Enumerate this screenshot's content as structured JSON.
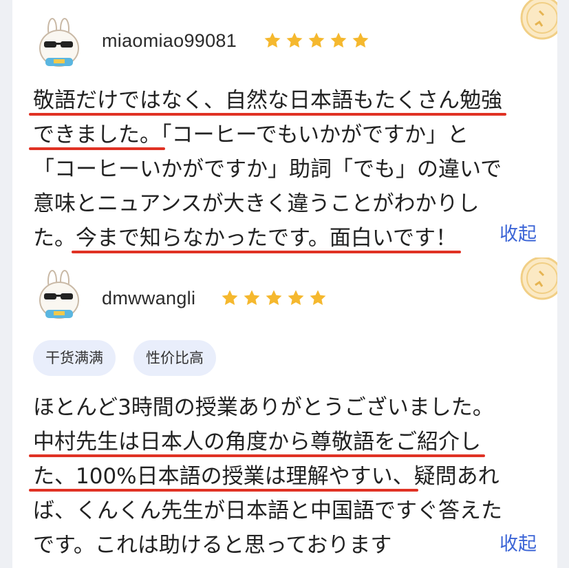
{
  "reviews": [
    {
      "username": "miaomiao99081",
      "rating": 5,
      "lines": [
        [
          {
            "t": "敬語だけではなく、自然な日本語もたくさん勉強",
            "u": true
          }
        ],
        [
          {
            "t": "できました。",
            "u": true
          },
          {
            "t": "「コーヒーでもいかがですか」と",
            "u": false
          }
        ],
        [
          {
            "t": "「コーヒーいかがですか」助詞「でも」の違いで",
            "u": false
          }
        ],
        [
          {
            "t": "意味とニュアンスが大きく違うことがわかりし",
            "u": false
          }
        ],
        [
          {
            "t": "た。",
            "u": false
          },
          {
            "t": "今まで知らなかったです。面白いです！",
            "u": true
          }
        ]
      ],
      "collapse_label": "收起"
    },
    {
      "username": "dmwwangli",
      "rating": 5,
      "tags": [
        "干货满满",
        "性价比高"
      ],
      "lines": [
        [
          {
            "t": "ほとんど3時間の授業ありがとうございました。",
            "u": false
          }
        ],
        [
          {
            "t": "中村先生は日本人の角度から尊敬語をご紹介し",
            "u": true
          }
        ],
        [
          {
            "t": "た、100%日本語の授業は理解やすい、",
            "u": true
          },
          {
            "t": "疑問あれ",
            "u": false
          }
        ],
        [
          {
            "t": "ば、くんくん先生が日本語と中国語ですぐ答えた",
            "u": false
          }
        ],
        [
          {
            "t": "です。これは助けると思っております",
            "u": false
          }
        ]
      ],
      "collapse_label": "收起"
    }
  ],
  "colors": {
    "underline": "#e03224",
    "star": "#f5b82e",
    "link": "#3b64d6",
    "tag_bg": "#e9eefb"
  },
  "icons": {
    "avatar": "bunny-sunglasses-avatar-icon",
    "star": "star-icon",
    "badge": "quality-badge-icon"
  }
}
